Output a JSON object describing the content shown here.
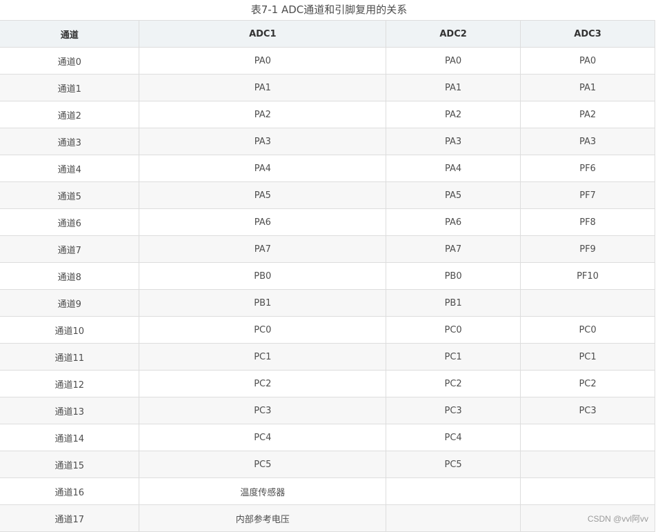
{
  "caption": "表7-1 ADC通道和引脚复用的关系",
  "table": {
    "headers": [
      "通道",
      "ADC1",
      "ADC2",
      "ADC3"
    ],
    "rows": [
      [
        "通道0",
        "PA0",
        "PA0",
        "PA0"
      ],
      [
        "通道1",
        "PA1",
        "PA1",
        "PA1"
      ],
      [
        "通道2",
        "PA2",
        "PA2",
        "PA2"
      ],
      [
        "通道3",
        "PA3",
        "PA3",
        "PA3"
      ],
      [
        "通道4",
        "PA4",
        "PA4",
        "PF6"
      ],
      [
        "通道5",
        "PA5",
        "PA5",
        "PF7"
      ],
      [
        "通道6",
        "PA6",
        "PA6",
        "PF8"
      ],
      [
        "通道7",
        "PA7",
        "PA7",
        "PF9"
      ],
      [
        "通道8",
        "PB0",
        "PB0",
        "PF10"
      ],
      [
        "通道9",
        "PB1",
        "PB1",
        ""
      ],
      [
        "通道10",
        "PC0",
        "PC0",
        "PC0"
      ],
      [
        "通道11",
        "PC1",
        "PC1",
        "PC1"
      ],
      [
        "通道12",
        "PC2",
        "PC2",
        "PC2"
      ],
      [
        "通道13",
        "PC3",
        "PC3",
        "PC3"
      ],
      [
        "通道14",
        "PC4",
        "PC4",
        ""
      ],
      [
        "通道15",
        "PC5",
        "PC5",
        ""
      ],
      [
        "通道16",
        "温度传感器",
        "",
        ""
      ],
      [
        "通道17",
        "内部参考电压",
        "",
        ""
      ]
    ]
  },
  "watermark": "CSDN @vvl阿vv",
  "colors": {
    "header_bg": "#eff3f5",
    "row_alt_bg": "#f7f7f7",
    "border": "#dddddd",
    "text": "#4d4d4d"
  }
}
